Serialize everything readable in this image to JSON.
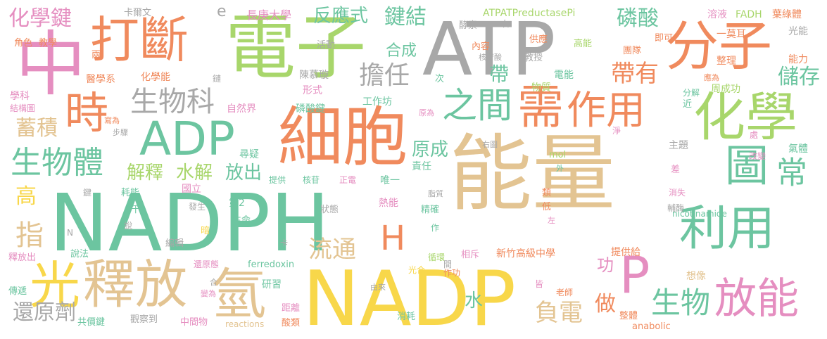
{
  "palette": {
    "green": "#a8d66b",
    "orange": "#f08a5d",
    "gray": "#a8a8a8",
    "teal": "#6cc5a0",
    "tan": "#e3c492",
    "pink": "#e58ec0",
    "yellow": "#f8d74a"
  },
  "words": [
    {
      "text": "能量",
      "color": "tan"
    },
    {
      "text": "NADPH",
      "color": "teal"
    },
    {
      "text": "ATP",
      "color": "gray"
    },
    {
      "text": "NADP",
      "color": "yellow"
    },
    {
      "text": "電子",
      "color": "green"
    },
    {
      "text": "細胞",
      "color": "orange"
    },
    {
      "text": "中",
      "color": "pink"
    },
    {
      "text": "打斷",
      "color": "orange"
    },
    {
      "text": "分子",
      "color": "orange"
    },
    {
      "text": "ADP",
      "color": "teal"
    },
    {
      "text": "化學",
      "color": "green"
    },
    {
      "text": "光",
      "color": "yellow"
    },
    {
      "text": "釋放",
      "color": "tan"
    },
    {
      "text": "氫",
      "color": "tan"
    },
    {
      "text": "需",
      "color": "orange"
    },
    {
      "text": "作用",
      "color": "orange"
    },
    {
      "text": "時",
      "color": "orange"
    },
    {
      "text": "之間",
      "color": "teal"
    },
    {
      "text": "利用",
      "color": "teal"
    },
    {
      "text": "圖",
      "color": "teal"
    },
    {
      "text": "放能",
      "color": "pink"
    },
    {
      "text": "P",
      "color": "pink"
    },
    {
      "text": "常",
      "color": "teal"
    },
    {
      "text": "生物體",
      "color": "teal"
    },
    {
      "text": "生物科",
      "color": "gray"
    },
    {
      "text": "化學鍵",
      "color": "pink"
    },
    {
      "text": "擔任",
      "color": "gray"
    },
    {
      "text": "鍵結",
      "color": "teal"
    },
    {
      "text": "磷酸",
      "color": "teal"
    },
    {
      "text": "反應式",
      "color": "teal"
    },
    {
      "text": "帶有",
      "color": "orange"
    },
    {
      "text": "儲存",
      "color": "teal"
    },
    {
      "text": "生物",
      "color": "teal"
    },
    {
      "text": "H",
      "color": "orange"
    },
    {
      "text": "指",
      "color": "tan"
    },
    {
      "text": "高",
      "color": "yellow"
    },
    {
      "text": "蓄積",
      "color": "tan"
    },
    {
      "text": "流通",
      "color": "tan"
    },
    {
      "text": "解釋",
      "color": "green"
    },
    {
      "text": "水解",
      "color": "green"
    },
    {
      "text": "放出",
      "color": "teal"
    },
    {
      "text": "原成",
      "color": "teal"
    },
    {
      "text": "帶",
      "color": "teal"
    },
    {
      "text": "合成",
      "color": "teal"
    },
    {
      "text": "負電",
      "color": "tan"
    },
    {
      "text": "做",
      "color": "orange"
    },
    {
      "text": "水",
      "color": "teal"
    },
    {
      "text": "功",
      "color": "pink"
    },
    {
      "text": "還原劑",
      "color": "gray"
    },
    {
      "text": "長庚大學",
      "color": "pink"
    },
    {
      "text": "e",
      "color": "gray"
    },
    {
      "text": "卡爾文",
      "color": "gray"
    },
    {
      "text": "ATPATPreductasePi",
      "color": "green"
    },
    {
      "text": "酵素",
      "color": "gray"
    },
    {
      "text": "右",
      "color": "gray"
    },
    {
      "text": "溶液",
      "color": "pink"
    },
    {
      "text": "FADH",
      "color": "green"
    },
    {
      "text": "葉綠體",
      "color": "orange"
    },
    {
      "text": "光能",
      "color": "gray"
    },
    {
      "text": "角色",
      "color": "orange"
    },
    {
      "text": "教學",
      "color": "orange"
    },
    {
      "text": "兩",
      "color": "orange"
    },
    {
      "text": "活動",
      "color": "gray"
    },
    {
      "text": "內容",
      "color": "orange"
    },
    {
      "text": "核苷酸",
      "color": "gray"
    },
    {
      "text": "教授",
      "color": "gray"
    },
    {
      "text": "供應",
      "color": "orange"
    },
    {
      "text": "高能",
      "color": "green"
    },
    {
      "text": "即可",
      "color": "orange"
    },
    {
      "text": "團隊",
      "color": "orange"
    },
    {
      "text": "一莫耳",
      "color": "orange"
    },
    {
      "text": "整理",
      "color": "orange"
    },
    {
      "text": "能力",
      "color": "orange"
    },
    {
      "text": "醫學系",
      "color": "orange"
    },
    {
      "text": "化學能",
      "color": "orange"
    },
    {
      "text": "鏈",
      "color": "gray"
    },
    {
      "text": "陳慕璇",
      "color": "gray"
    },
    {
      "text": "次",
      "color": "teal"
    },
    {
      "text": "電能",
      "color": "teal"
    },
    {
      "text": "應為",
      "color": "orange"
    },
    {
      "text": "物質",
      "color": "green"
    },
    {
      "text": "周成功",
      "color": "green"
    },
    {
      "text": "分解",
      "color": "teal"
    },
    {
      "text": "學科",
      "color": "pink"
    },
    {
      "text": "結構圖",
      "color": "pink"
    },
    {
      "text": "形式",
      "color": "pink"
    },
    {
      "text": "工作坊",
      "color": "teal"
    },
    {
      "text": "近",
      "color": "teal"
    },
    {
      "text": "寫為",
      "color": "orange"
    },
    {
      "text": "步驟",
      "color": "gray"
    },
    {
      "text": "自然界",
      "color": "pink"
    },
    {
      "text": "磷酸鍵",
      "color": "teal"
    },
    {
      "text": "原為",
      "color": "pink"
    },
    {
      "text": "淨",
      "color": "pink"
    },
    {
      "text": "處",
      "color": "pink"
    },
    {
      "text": "尋疑",
      "color": "teal"
    },
    {
      "text": "右圖",
      "color": "gray"
    },
    {
      "text": "主題",
      "color": "gray"
    },
    {
      "text": "氣體",
      "color": "teal"
    },
    {
      "text": "改變",
      "color": "pink"
    },
    {
      "text": "mol",
      "color": "green"
    },
    {
      "text": "外",
      "color": "teal"
    },
    {
      "text": "責任",
      "color": "teal"
    },
    {
      "text": "提供",
      "color": "teal"
    },
    {
      "text": "核苷",
      "color": "teal"
    },
    {
      "text": "正電",
      "color": "pink"
    },
    {
      "text": "唯一",
      "color": "teal"
    },
    {
      "text": "差",
      "color": "pink"
    },
    {
      "text": "消失",
      "color": "pink"
    },
    {
      "text": "國立",
      "color": "pink"
    },
    {
      "text": "鍵",
      "color": "gray"
    },
    {
      "text": "耗能",
      "color": "teal"
    },
    {
      "text": "第2",
      "color": "teal"
    },
    {
      "text": "發生",
      "color": "gray"
    },
    {
      "text": "脂質",
      "color": "gray"
    },
    {
      "text": "類",
      "color": "orange"
    },
    {
      "text": "低",
      "color": "orange"
    },
    {
      "text": "輔酶",
      "color": "gray"
    },
    {
      "text": "nicotinamide",
      "color": "teal"
    },
    {
      "text": "3千",
      "color": "teal"
    },
    {
      "text": "熱能",
      "color": "pink"
    },
    {
      "text": "精確",
      "color": "teal"
    },
    {
      "text": "狀態",
      "color": "gray"
    },
    {
      "text": "生命",
      "color": "teal"
    },
    {
      "text": "說",
      "color": "gray"
    },
    {
      "text": "作",
      "color": "teal"
    },
    {
      "text": "左",
      "color": "pink"
    },
    {
      "text": "N",
      "color": "gray"
    },
    {
      "text": "暗",
      "color": "yellow"
    },
    {
      "text": "編輯",
      "color": "gray"
    },
    {
      "text": "說法",
      "color": "teal"
    },
    {
      "text": "卡",
      "color": "gray"
    },
    {
      "text": "相斥",
      "color": "pink"
    },
    {
      "text": "新竹高級中學",
      "color": "orange"
    },
    {
      "text": "提供給",
      "color": "orange"
    },
    {
      "text": "釋放出",
      "color": "pink"
    },
    {
      "text": "還原態",
      "color": "pink"
    },
    {
      "text": "ferredoxin",
      "color": "teal"
    },
    {
      "text": "循環",
      "color": "green"
    },
    {
      "text": "間",
      "color": "gray"
    },
    {
      "text": "光合",
      "color": "yellow"
    },
    {
      "text": "作功",
      "color": "orange"
    },
    {
      "text": "想像",
      "color": "tan"
    },
    {
      "text": "傳遞",
      "color": "teal"
    },
    {
      "text": "合",
      "color": "gray"
    },
    {
      "text": "變為",
      "color": "pink"
    },
    {
      "text": "研習",
      "color": "teal"
    },
    {
      "text": "由來",
      "color": "gray"
    },
    {
      "text": "皆",
      "color": "pink"
    },
    {
      "text": "老師",
      "color": "orange"
    },
    {
      "text": "距離",
      "color": "pink"
    },
    {
      "text": "觀察到",
      "color": "gray"
    },
    {
      "text": "共價鍵",
      "color": "teal"
    },
    {
      "text": "中間物",
      "color": "pink"
    },
    {
      "text": "reactions",
      "color": "tan"
    },
    {
      "text": "酸類",
      "color": "orange"
    },
    {
      "text": "消耗",
      "color": "teal"
    },
    {
      "text": "整體",
      "color": "orange"
    },
    {
      "text": "anabolic",
      "color": "orange"
    }
  ]
}
